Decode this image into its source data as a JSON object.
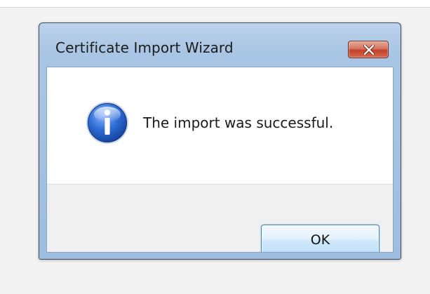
{
  "window": {
    "title": "Certificate Import Wizard",
    "close_icon": "close-icon"
  },
  "message": {
    "icon": "info-icon",
    "text": "The import was successful."
  },
  "buttons": {
    "ok_label": "OK"
  },
  "colors": {
    "frame": "#a9c5e4",
    "close_button": "#c24128",
    "ok_button_border": "#3c7fb1",
    "info_icon": "#2d63c8"
  }
}
